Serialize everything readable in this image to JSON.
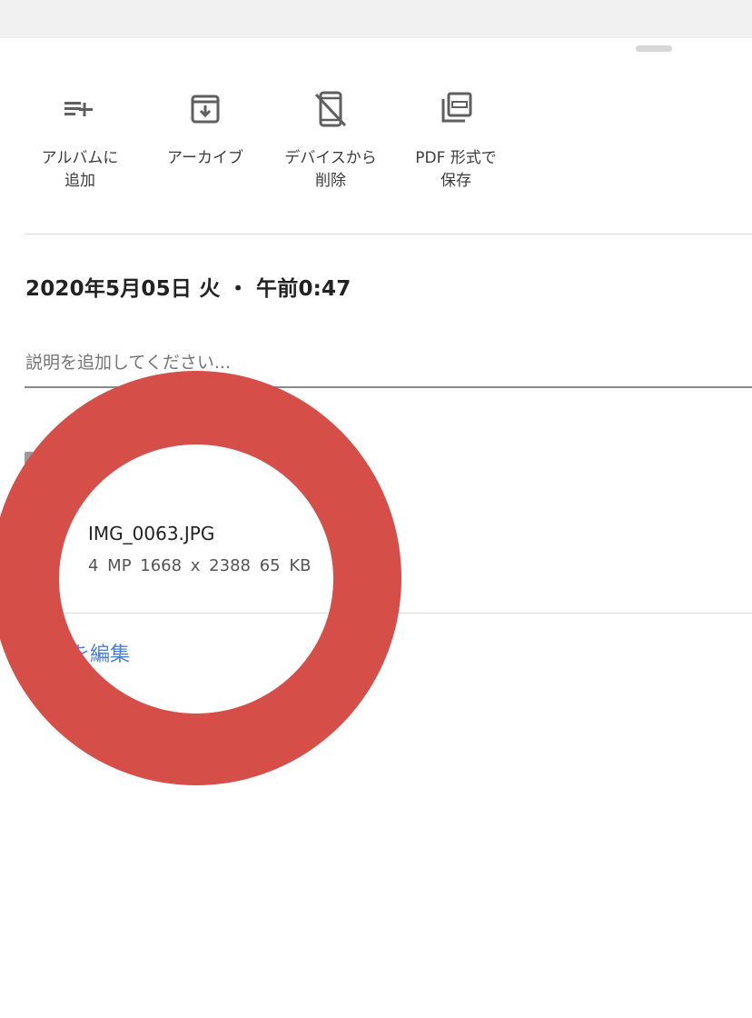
{
  "actions": [
    {
      "label": "アルバムに\n追加",
      "icon": "playlist-add-icon"
    },
    {
      "label": "アーカイブ",
      "icon": "archive-icon"
    },
    {
      "label": "デバイスから\n削除",
      "icon": "mobile-off-icon"
    },
    {
      "label": "PDF 形式で\n保存",
      "icon": "pdf-icon"
    }
  ],
  "details": {
    "datetime": "2020年5月05日 火 ・ 午前0:47",
    "description_placeholder": "説明を追加してください..."
  },
  "file": {
    "name": "IMG_0063.JPG",
    "meta": "4 MP   1668 x 2388   65 KB"
  },
  "edit_link": "を編集",
  "colors": {
    "annotation_ring": "#d54f48",
    "link": "#4a7fd8",
    "top_bar": "#f1f1f1"
  }
}
